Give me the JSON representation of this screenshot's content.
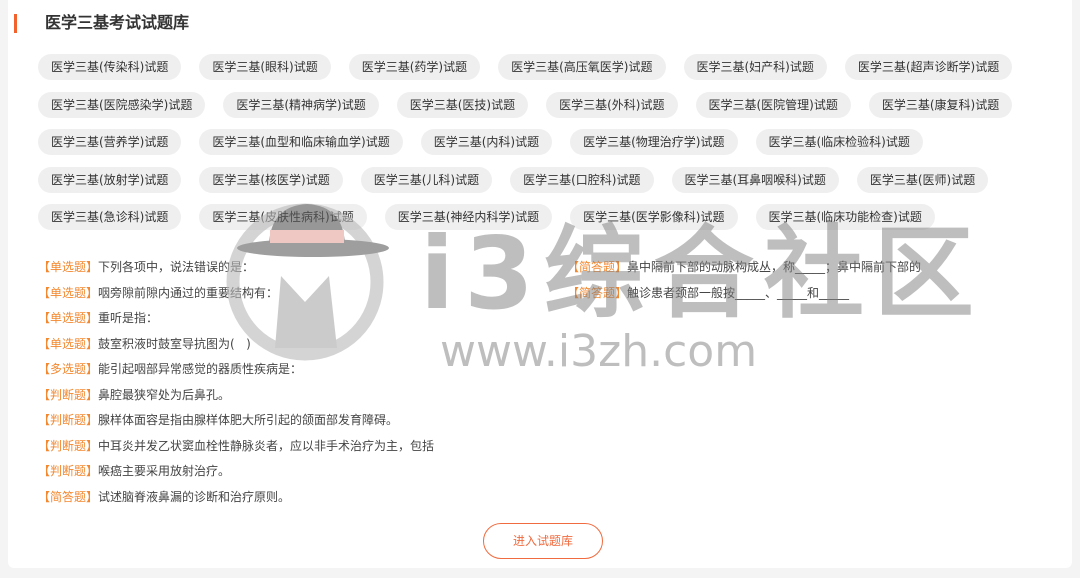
{
  "section": {
    "title": "医学三基考试试题库"
  },
  "tag_rows": [
    [
      "医学三基(传染科)试题",
      "医学三基(眼科)试题",
      "医学三基(药学)试题",
      "医学三基(高压氧医学)试题",
      "医学三基(妇产科)试题",
      "医学三基(超声诊断学)试题"
    ],
    [
      "医学三基(医院感染学)试题",
      "医学三基(精神病学)试题",
      "医学三基(医技)试题",
      "医学三基(外科)试题",
      "医学三基(医院管理)试题",
      "医学三基(康复科)试题"
    ],
    [
      "医学三基(营养学)试题",
      "医学三基(血型和临床输血学)试题",
      "医学三基(内科)试题",
      "医学三基(物理治疗学)试题",
      "医学三基(临床检验科)试题"
    ],
    [
      "医学三基(放射学)试题",
      "医学三基(核医学)试题",
      "医学三基(儿科)试题",
      "医学三基(口腔科)试题",
      "医学三基(耳鼻咽喉科)试题",
      "医学三基(医师)试题"
    ],
    [
      "医学三基(急诊科)试题",
      "医学三基(皮肤性病科)试题",
      "医学三基(神经内科学)试题",
      "医学三基(医学影像科)试题",
      "医学三基(临床功能检查)试题"
    ]
  ],
  "questions": {
    "left": [
      {
        "type": "【单选题】",
        "text": "下列各项中，说法错误的是："
      },
      {
        "type": "【单选题】",
        "text": "咽旁隙前隙内通过的重要结构有："
      },
      {
        "type": "【单选题】",
        "text": "重听是指："
      },
      {
        "type": "【单选题】",
        "text": "鼓室积液时鼓室导抗图为(   )"
      },
      {
        "type": "【多选题】",
        "text": "能引起咽部异常感觉的器质性疾病是："
      },
      {
        "type": "【判断题】",
        "text": "鼻腔最狭窄处为后鼻孔。"
      },
      {
        "type": "【判断题】",
        "text": "腺样体面容是指由腺样体肥大所引起的颌面部发育障碍。"
      },
      {
        "type": "【判断题】",
        "text": "中耳炎并发乙状窦血栓性静脉炎者，应以非手术治疗为主，包括"
      },
      {
        "type": "【判断题】",
        "text": "喉癌主要采用放射治疗。"
      },
      {
        "type": "【简答题】",
        "text": "试述脑脊液鼻漏的诊断和治疗原则。"
      }
    ],
    "right": [
      {
        "type": "【简答题】",
        "text": "鼻中隔前下部的动脉构成丛，称_____；鼻中隔前下部的"
      },
      {
        "type": "【简答题】",
        "text": "触诊患者颈部一般按_____、_____和_____"
      }
    ]
  },
  "enter_button": {
    "label": "进入试题库"
  },
  "colors": {
    "accent": "#f2622c",
    "type_label": "#f3882f",
    "button": "#f06b3f",
    "tag_bg": "#efefef",
    "text": "#333333"
  },
  "watermark": {
    "brand": "i3综合社区",
    "url": "www.i3zh.com"
  }
}
